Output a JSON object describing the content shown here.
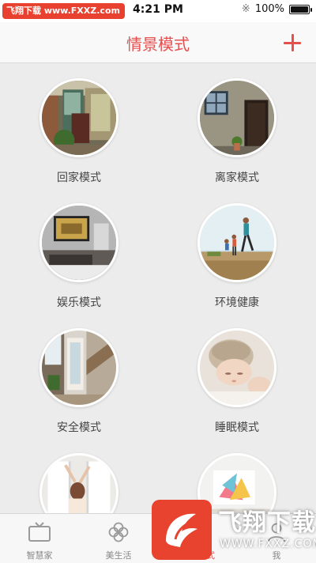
{
  "status_bar": {
    "watermark": "飞翔下载 www.FXXZ.com",
    "time": "4:21 PM",
    "battery": "100%",
    "battery_level": 1.0
  },
  "nav": {
    "title": "情景模式",
    "add_icon": "plus-icon"
  },
  "scenes": [
    {
      "label": "回家模式",
      "image": "living-room-photo"
    },
    {
      "label": "离家模式",
      "image": "stone-house-photo"
    },
    {
      "label": "娱乐模式",
      "image": "tv-room-photo"
    },
    {
      "label": "环境健康",
      "image": "running-family-photo"
    },
    {
      "label": "安全模式",
      "image": "hallway-photo"
    },
    {
      "label": "睡眠模式",
      "image": "sleeping-baby-photo"
    },
    {
      "label": "",
      "image": "stretching-woman-photo"
    },
    {
      "label": "",
      "image": "bright-interior-photo"
    }
  ],
  "tabs": [
    {
      "label": "智慧家",
      "icon": "tv-icon",
      "active": false
    },
    {
      "label": "美生活",
      "icon": "clover-icon",
      "active": false
    },
    {
      "label": "情景模式",
      "icon": "scene-icon",
      "active": true
    },
    {
      "label": "我",
      "icon": "profile-icon",
      "active": false
    }
  ],
  "watermark": {
    "text": "飞翔下载",
    "url": "WWW.FXXZ.COM"
  },
  "colors": {
    "accent": "#e5504f",
    "background": "#ececec",
    "watermark": "#e8432e"
  }
}
